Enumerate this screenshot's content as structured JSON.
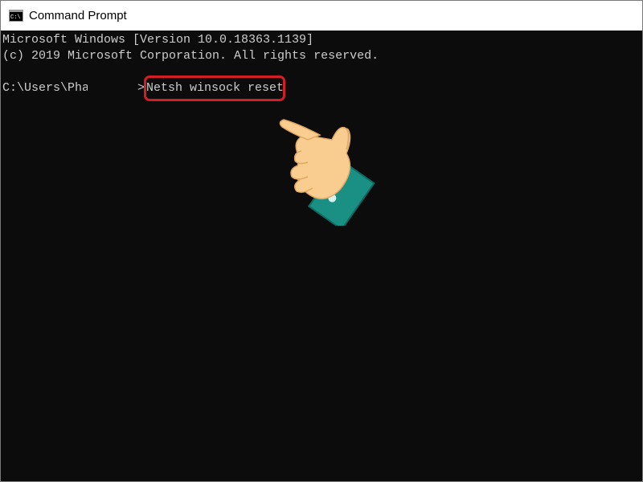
{
  "window": {
    "title": "Command Prompt",
    "icon": "cmd-icon"
  },
  "console": {
    "lines": [
      "Microsoft Windows [Version 10.0.18363.1139]",
      "(c) 2019 Microsoft Corporation. All rights reserved."
    ],
    "prompt_path": "C:\\Users\\Pha",
    "prompt_symbol": ">",
    "command": "Netsh winsock reset"
  },
  "annotation": {
    "highlight_color": "#d41e25",
    "pointer_icon": "pointing-hand-icon"
  },
  "colors": {
    "console_background": "#0c0c0c",
    "console_text": "#cccccc",
    "titlebar_background": "#ffffff"
  }
}
